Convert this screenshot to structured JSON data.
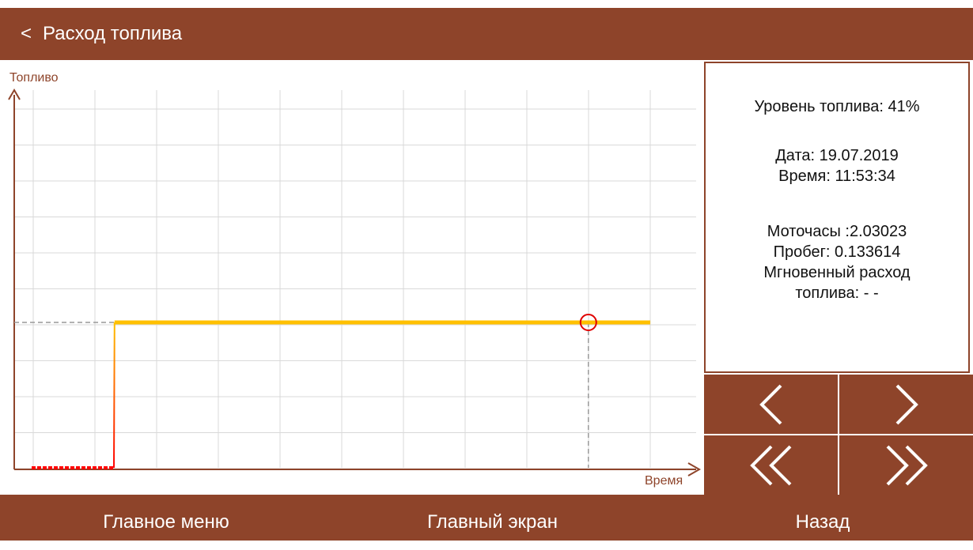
{
  "header": {
    "back_label": "<",
    "title": "Расход топлива"
  },
  "colors": {
    "brand": "#8e442a",
    "fuel_line": "#ffc000",
    "low_line": "#ff0000",
    "marker": "#e00000",
    "grid": "#d9d9d9"
  },
  "chart_data": {
    "type": "line",
    "xlabel": "Время",
    "ylabel": "Топливо",
    "ylim": [
      0,
      100
    ],
    "series": [
      {
        "values_x": [
          0,
          13.3,
          13.4,
          100
        ],
        "values_y": [
          0,
          0,
          41,
          41
        ]
      }
    ],
    "cursor": {
      "x": 90,
      "y": 41
    },
    "grid": true
  },
  "info": {
    "fuel_level": "Уровень топлива: 41%",
    "date": "Дата: 19.07.2019",
    "time": "Время: 11:53:34",
    "engine_hours": "Моточасы :2.03023",
    "mileage": "Пробег: 0.133614",
    "instant_line1": "Мгновенный расход",
    "instant_line2": "топлива: - -"
  },
  "navigation": {
    "prev_icon": "chevron-left-icon",
    "next_icon": "chevron-right-icon",
    "fast_prev_icon": "double-chevron-left-icon",
    "fast_next_icon": "double-chevron-right-icon"
  },
  "footer": {
    "main_menu": "Главное меню",
    "main_screen": "Главный экран",
    "back": "Назад"
  }
}
